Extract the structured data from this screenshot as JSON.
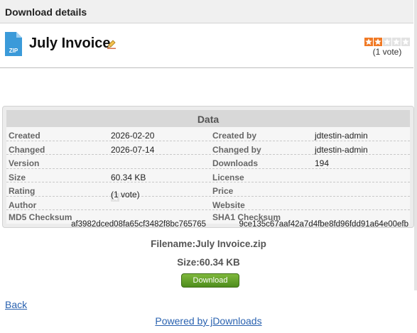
{
  "header": {
    "title": "Download details"
  },
  "document": {
    "title": "July Invoice",
    "file_icon_label": "ZIP",
    "rating": {
      "value": 2,
      "max": 5,
      "votes_text": "(1 vote)"
    }
  },
  "data_panel": {
    "title": "Data",
    "rows": [
      {
        "l1": "Created",
        "v1": "2026-02-20",
        "l2": "Created by",
        "v2": "jdtestin-admin"
      },
      {
        "l1": "Changed",
        "v1": "2026-07-14",
        "l2": "Changed by",
        "v2": "jdtestin-admin"
      },
      {
        "l1": "Version",
        "v1": "",
        "l2": "Downloads",
        "v2": "194"
      },
      {
        "l1": "Size",
        "v1": "60.34 KB",
        "l2": "License",
        "v2": ""
      },
      {
        "l1": "Rating",
        "v1": "(1 vote)",
        "l2": "Price",
        "v2": ""
      },
      {
        "l1": "Author",
        "v1": "",
        "l2": "Website",
        "v2": ""
      }
    ],
    "checksums": {
      "md5_label": "MD5 Checksum",
      "md5_value": "af3982dced08fa65cf3482f8bc765765",
      "sha1_label": "SHA1 Checksum",
      "sha1_value": "9ce135c67aaf42a7d4fbe8fd96fdd91a64e00efb"
    }
  },
  "file_info": {
    "filename_line": "Filename:July Invoice.zip",
    "size_line": "Size:60.34 KB"
  },
  "actions": {
    "download_label": "Download"
  },
  "footer": {
    "back_label": "Back",
    "powered_label": "Powered by jDownloads"
  },
  "colors": {
    "star_on": "#f07a26",
    "star_off": "#e2e2e2",
    "download_button": "#5e9e27",
    "link": "#2a62b0",
    "zip_icon": "#3b9ad9"
  },
  "icons": {
    "file": "zip-file-icon",
    "edit": "edit-pencil-icon",
    "star": "star-icon"
  }
}
